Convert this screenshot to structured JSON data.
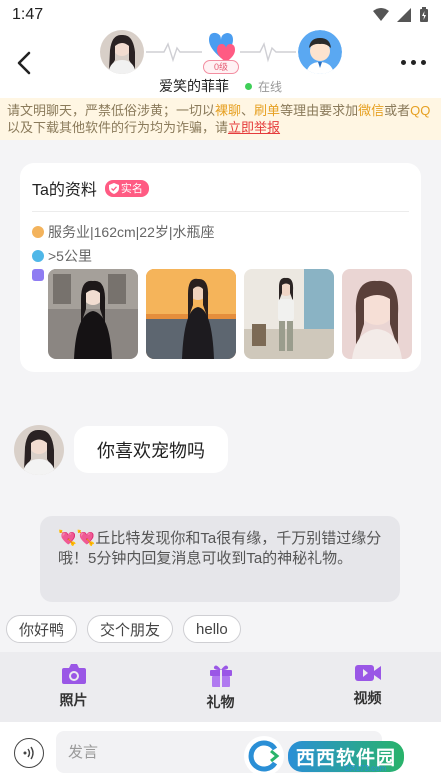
{
  "status": {
    "time": "1:47"
  },
  "header": {
    "contact_name": "爱笑的菲菲",
    "level": "0级",
    "online_status": "在线"
  },
  "warning": {
    "part1": "请文明聊天，严禁低俗涉黄；一切以",
    "kw1": "裸聊",
    "sep1": "、",
    "kw2": "刷单",
    "part2": "等理由要求加",
    "kw3": "微信",
    "part3": "或者",
    "kw4": "QQ",
    "part4": "以及下载其他软件的行为均为诈骗，请",
    "report": "立即举报"
  },
  "profile": {
    "title": "Ta的资料",
    "badge": "实名",
    "info": "服务业|162cm|22岁|水瓶座",
    "distance": ">5公里"
  },
  "message": {
    "text": "你喜欢宠物吗"
  },
  "system_tip": {
    "emoji": "💘💘",
    "text": "丘比特发现你和Ta很有缘，千万别错过缘分哦！5分钟内回复消息可收到Ta的神秘礼物。"
  },
  "quick_replies": [
    "你好鸭",
    "交个朋友",
    "hello"
  ],
  "toolbar": {
    "photo": "照片",
    "gift": "礼物",
    "video": "视频"
  },
  "input": {
    "placeholder": "发言"
  },
  "watermark": {
    "text": "西西软件园",
    "sub": "CR173.com"
  }
}
